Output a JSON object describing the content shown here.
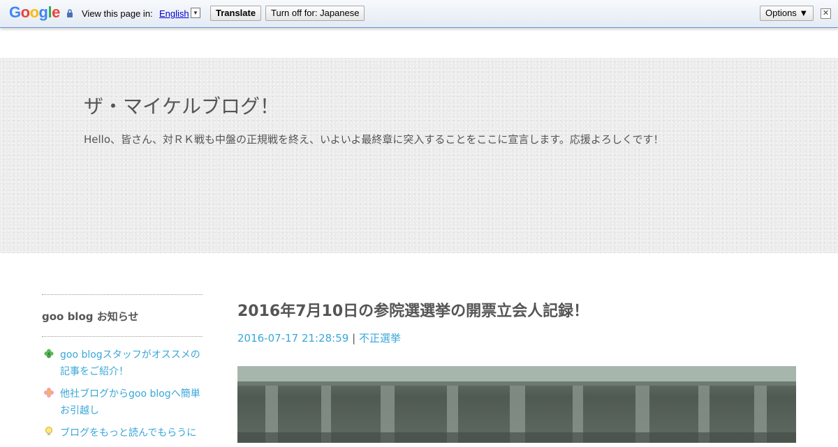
{
  "translate_bar": {
    "logo": "Google",
    "view_label": "View this page in:",
    "language": "English",
    "translate_label": "Translate",
    "turn_off_label": "Turn off for: Japanese",
    "options_label": "Options ▼"
  },
  "header": {
    "title": "ザ・マイケルブログ！",
    "description": "Hello、皆さん、対ＲＫ戦も中盤の正規戦を終え、いよいよ最終章に突入することをここに宣言します。応援よろしくです！"
  },
  "sidebar": {
    "heading": "goo blog お知らせ",
    "items": [
      {
        "label": "goo blogスタッフがオススメの記事をご紹介！",
        "icon": "clover-icon"
      },
      {
        "label": "他社ブログからgoo blogへ簡単お引越し",
        "icon": "flower-icon"
      },
      {
        "label": "ブログをもっと読んでもらうに",
        "icon": "lightbulb-icon"
      }
    ]
  },
  "post": {
    "title": "2016年7月10日の参院選選挙の開票立会人記録！",
    "date": "2016-07-17 21:28:59",
    "separator": "|",
    "category": "不正選挙"
  },
  "colors": {
    "link": "#39a7d8",
    "text": "#555555",
    "header_bg": "#ececec"
  }
}
